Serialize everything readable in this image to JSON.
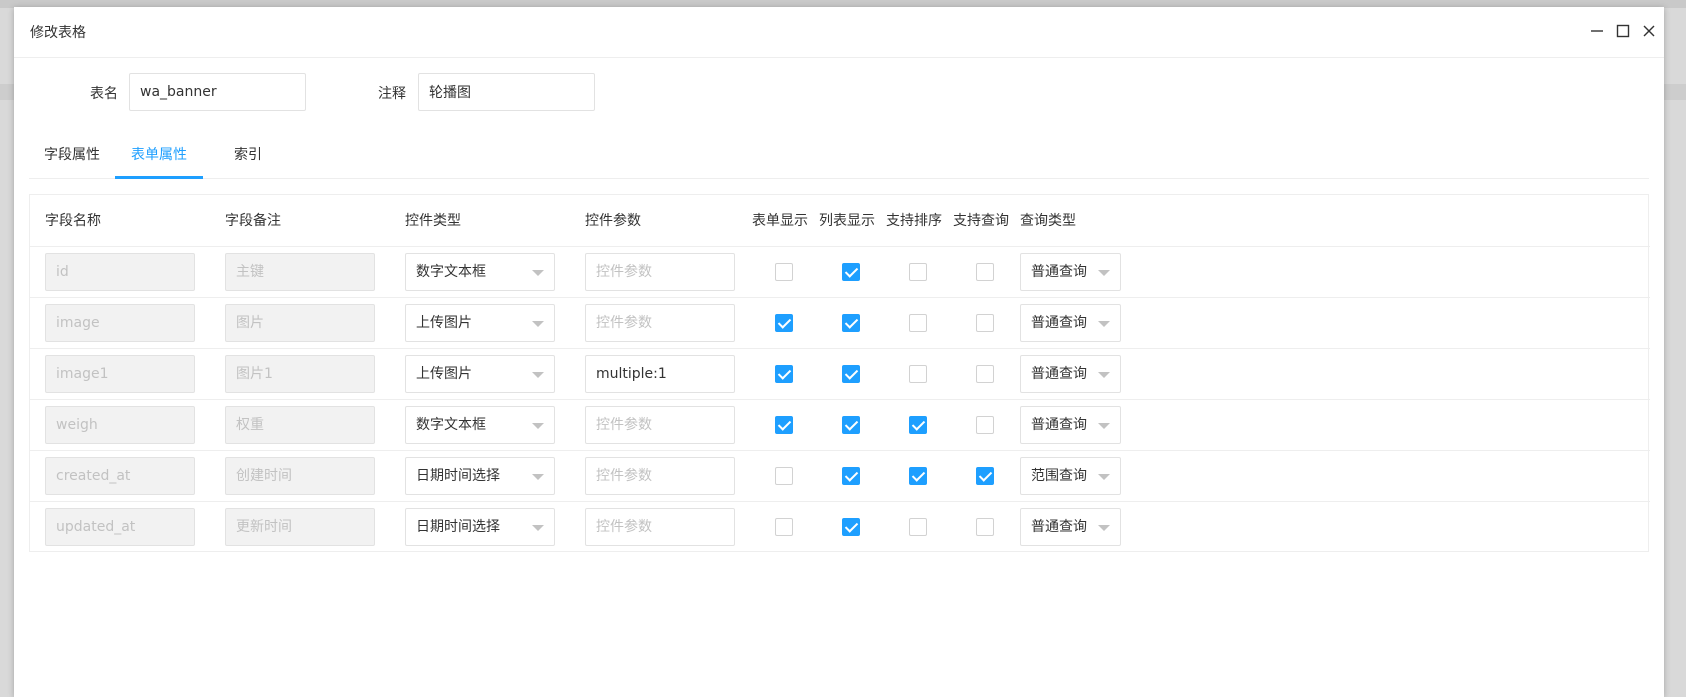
{
  "dialog": {
    "title": "修改表格",
    "controls": [
      "minimize-icon",
      "maximize-icon",
      "close-icon"
    ]
  },
  "meta": {
    "table_name_label": "表名",
    "table_name_value": "wa_banner",
    "comment_label": "注释",
    "comment_value": "轮播图"
  },
  "tabs": [
    {
      "label": "字段属性",
      "active": false
    },
    {
      "label": "表单属性",
      "active": true
    },
    {
      "label": "索引",
      "active": false
    }
  ],
  "colors": {
    "accent": "#1e9fff",
    "disabled_bg": "#f2f2f2",
    "placeholder": "#c2c2c2"
  },
  "table": {
    "headers": [
      "字段名称",
      "字段备注",
      "控件类型",
      "控件参数",
      "表单显示",
      "列表显示",
      "支持排序",
      "支持查询",
      "查询类型"
    ],
    "param_placeholder": "控件参数",
    "rows": [
      {
        "name": "id",
        "remark": "主键",
        "control": "数字文本框",
        "param": "",
        "form_show": false,
        "list_show": true,
        "sortable": false,
        "searchable": false,
        "query_type": "普通查询"
      },
      {
        "name": "image",
        "remark": "图片",
        "control": "上传图片",
        "param": "",
        "form_show": true,
        "list_show": true,
        "sortable": false,
        "searchable": false,
        "query_type": "普通查询"
      },
      {
        "name": "image1",
        "remark": "图片1",
        "control": "上传图片",
        "param": "multiple:1",
        "form_show": true,
        "list_show": true,
        "sortable": false,
        "searchable": false,
        "query_type": "普通查询"
      },
      {
        "name": "weigh",
        "remark": "权重",
        "control": "数字文本框",
        "param": "",
        "form_show": true,
        "list_show": true,
        "sortable": true,
        "searchable": false,
        "query_type": "普通查询"
      },
      {
        "name": "created_at",
        "remark": "创建时间",
        "control": "日期时间选择",
        "param": "",
        "form_show": false,
        "list_show": true,
        "sortable": true,
        "searchable": true,
        "query_type": "范围查询"
      },
      {
        "name": "updated_at",
        "remark": "更新时间",
        "control": "日期时间选择",
        "param": "",
        "form_show": false,
        "list_show": true,
        "sortable": false,
        "searchable": false,
        "query_type": "普通查询"
      }
    ]
  }
}
